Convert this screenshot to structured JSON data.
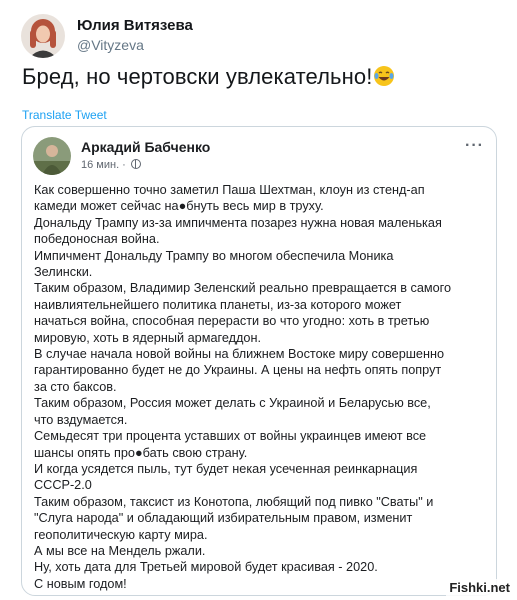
{
  "tweet": {
    "author_name": "Юлия Витязева",
    "author_handle": "@Vityzeva",
    "text": "Бред, но чертовски увлекательно!",
    "emoji": "face-with-tears-of-joy-icon",
    "translate_label": "Translate Tweet"
  },
  "quoted_post": {
    "author_name": "Аркадий Бабченко",
    "time": "16 мин. ·",
    "more_label": "···",
    "lines": [
      "Как совершенно точно заметил Паша Шехтман, клоун из стенд-ап",
      "камеди может сейчас на●бнуть весь мир в труху.",
      "Дональду Трампу из-за импичмента позарез нужна новая маленькая",
      "победоносная война.",
      "Импичмент Дональду Трампу во многом обеспечила Моника",
      "Зелински.",
      "Таким образом, Владимир Зеленский реально превращается в самого",
      "наивлиятельнейшего политика планеты, из-за которого может",
      "начаться война, способная перерасти во что угодно: хоть в третью",
      "мировую, хоть в ядерный армагеддон.",
      "В случае начала новой войны на ближнем Востоке миру совершенно",
      "гарантированно будет не до Украины. А цены на нефть опять попрут",
      "за сто баксов.",
      "Таким образом, Россия может делать с Украиной и Беларусью все,",
      "что вздумается.",
      "Семьдесят три процента уставших от войны украинцев имеют все",
      "шансы опять про●бать свою страну.",
      "И когда усядется пыль, тут будет некая усеченная реинкарнация",
      "СССР-2.0",
      "Таким образом, таксист из Конотопа, любящий под пивко \"Сваты\" и",
      "\"Слуга народа\" и обладающий избирательным правом, изменит",
      "геополитическую карту мира.",
      "А мы все на Мендель ржали.",
      "Ну, хоть дата для Третьей мировой будет красивая - 2020.",
      "С новым годом!"
    ]
  },
  "watermark": "Fishki.net",
  "colors": {
    "link": "#1da1f2",
    "secondary_text": "#657786",
    "border": "#ccd6dd"
  }
}
